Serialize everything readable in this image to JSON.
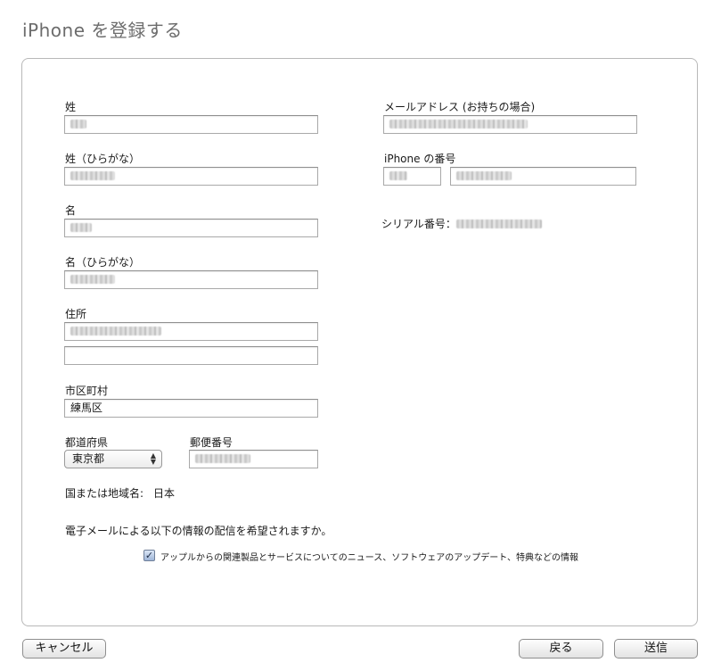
{
  "page": {
    "title": "iPhone を登録する"
  },
  "form": {
    "last_name_label": "姓",
    "last_name_kana_label": "姓（ひらがな）",
    "first_name_label": "名",
    "first_name_kana_label": "名（ひらがな）",
    "address_label": "住所",
    "city_label": "市区町村",
    "city_value": "練馬区",
    "prefecture_label": "都道府県",
    "prefecture_value": "東京都",
    "postal_label": "郵便番号",
    "country_label": "国または地域名:",
    "country_value": "日本",
    "email_label": "メールアドレス (お持ちの場合)",
    "phone_label": "iPhone の番号",
    "serial_label": "シリアル番号："
  },
  "optin": {
    "question": "電子メールによる以下の情報の配信を希望されますか。",
    "checkbox_label": "アップルからの関連製品とサービスについてのニュース、ソフトウェアのアップデート、特典などの情報",
    "checked": true
  },
  "buttons": {
    "cancel": "キャンセル",
    "back": "戻る",
    "send": "送信"
  },
  "icons": {
    "checkmark": "check-icon",
    "select_arrows": "updown-arrows-icon"
  }
}
